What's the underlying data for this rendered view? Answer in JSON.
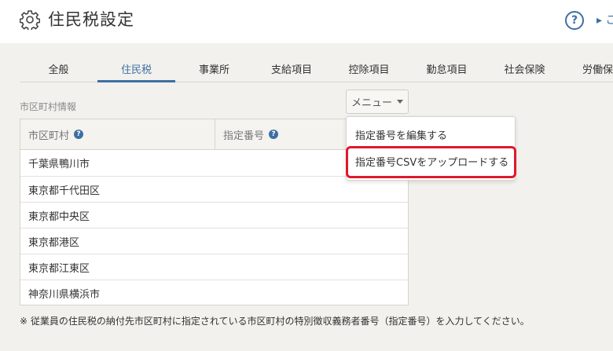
{
  "header": {
    "title": "住民税設定",
    "help_label": "?",
    "link_text": "▸ こ"
  },
  "tabs": [
    {
      "label": "全般"
    },
    {
      "label": "住民税",
      "active": true
    },
    {
      "label": "事業所"
    },
    {
      "label": "支給項目"
    },
    {
      "label": "控除項目"
    },
    {
      "label": "勤怠項目"
    },
    {
      "label": "社会保険"
    },
    {
      "label": "労働保"
    }
  ],
  "section": {
    "label": "市区町村情報"
  },
  "menu": {
    "button_label": "メニュー",
    "items": [
      "指定番号を編集する",
      "指定番号CSVをアップロードする"
    ],
    "highlighted_item": "指定番号CSVをアップロードする"
  },
  "table": {
    "headers": [
      "市区町村",
      "指定番号"
    ],
    "rows": [
      "千葉県鴨川市",
      "東京都千代田区",
      "東京都中央区",
      "東京都港区",
      "東京都江東区",
      "神奈川県横浜市"
    ]
  },
  "footnote": "※ 従業員の住民税の納付先市区町村に指定されている市区町村の特別徴収義務者番号（指定番号）を入力してください。",
  "colors": {
    "accent": "#3d6fa3",
    "highlight": "#e0182d",
    "background": "#f2f1ed"
  }
}
